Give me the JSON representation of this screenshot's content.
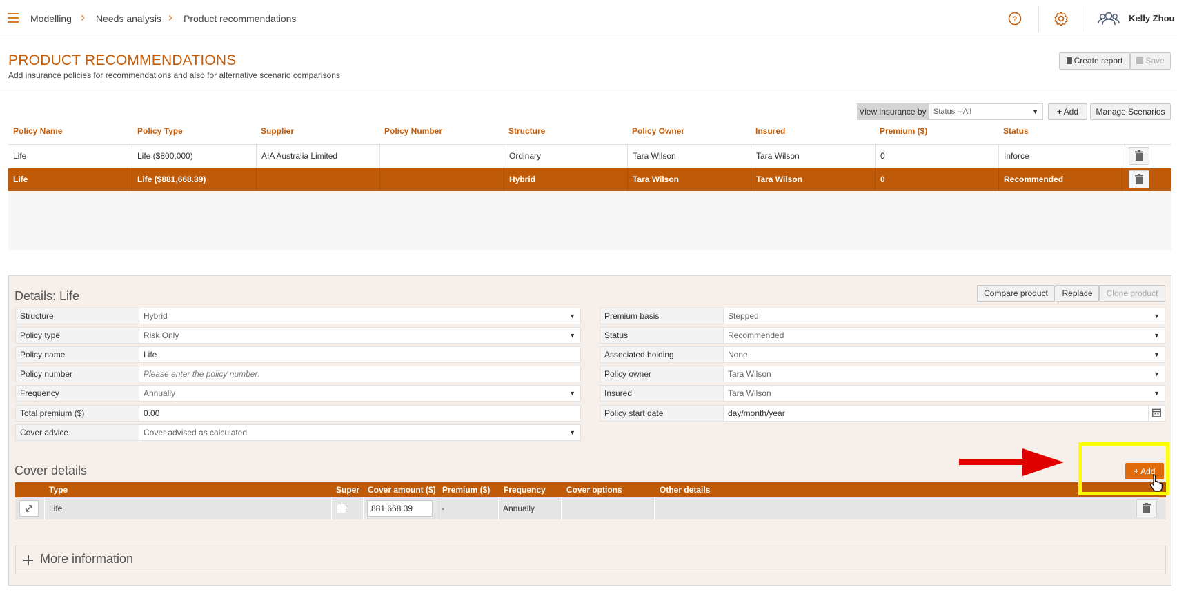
{
  "topbar": {
    "breadcrumbs": [
      "Modelling",
      "Needs analysis",
      "Product recommendations"
    ],
    "user_name": "Kelly Zhou"
  },
  "page": {
    "title": "PRODUCT RECOMMENDATIONS",
    "subtitle": "Add insurance policies for recommendations and also for alternative scenario comparisons",
    "create_report_label": "Create report",
    "save_label": "Save"
  },
  "view_by": {
    "label": "View insurance by",
    "selected": "Status – All",
    "add_label": "Add",
    "manage_label": "Manage Scenarios"
  },
  "policies": {
    "headers": [
      "Policy Name",
      "Policy Type",
      "Supplier",
      "Policy Number",
      "Structure",
      "Policy Owner",
      "Insured",
      "Premium ($)",
      "Status"
    ],
    "rows": [
      {
        "name": "Life",
        "type": "Life ($800,000)",
        "supplier": "AIA Australia Limited",
        "number": "",
        "structure": "Ordinary",
        "owner": "Tara Wilson",
        "insured": "Tara Wilson",
        "premium": "0",
        "status": "Inforce"
      },
      {
        "name": "Life",
        "type": "Life ($881,668.39)",
        "supplier": "",
        "number": "",
        "structure": "Hybrid",
        "owner": "Tara Wilson",
        "insured": "Tara Wilson",
        "premium": "0",
        "status": "Recommended"
      }
    ]
  },
  "details": {
    "title": "Details: Life",
    "compare_label": "Compare product",
    "replace_label": "Replace",
    "clone_label": "Clone product",
    "left": [
      {
        "label": "Structure",
        "value": "Hybrid"
      },
      {
        "label": "Policy type",
        "value": "Risk Only"
      },
      {
        "label": "Policy name",
        "value": "Life"
      },
      {
        "label": "Policy number",
        "value": "Please enter the policy number."
      },
      {
        "label": "Frequency",
        "value": "Annually"
      },
      {
        "label": "Total premium ($)",
        "value": "0.00"
      },
      {
        "label": "Cover advice",
        "value": "Cover advised as calculated"
      }
    ],
    "right": [
      {
        "label": "Premium basis",
        "value": "Stepped"
      },
      {
        "label": "Status",
        "value": "Recommended"
      },
      {
        "label": "Associated holding",
        "value": "None"
      },
      {
        "label": "Policy owner",
        "value": "Tara Wilson"
      },
      {
        "label": "Insured",
        "value": "Tara Wilson"
      },
      {
        "label": "Policy start date",
        "value": "day/month/year"
      }
    ]
  },
  "cover": {
    "title": "Cover details",
    "add_label": "Add",
    "headers": [
      "Type",
      "Super",
      "Cover amount ($)",
      "Premium ($)",
      "Frequency",
      "Cover options",
      "Other details"
    ],
    "row": {
      "type": "Life",
      "amount": "881,668.39",
      "premium": "-",
      "frequency": "Annually"
    }
  },
  "more_info": {
    "label": "More information"
  },
  "colors": {
    "accent": "#bf5b08",
    "brand_orange": "#e07b1a",
    "highlight": "#ffff00",
    "arrow": "#e00000"
  }
}
